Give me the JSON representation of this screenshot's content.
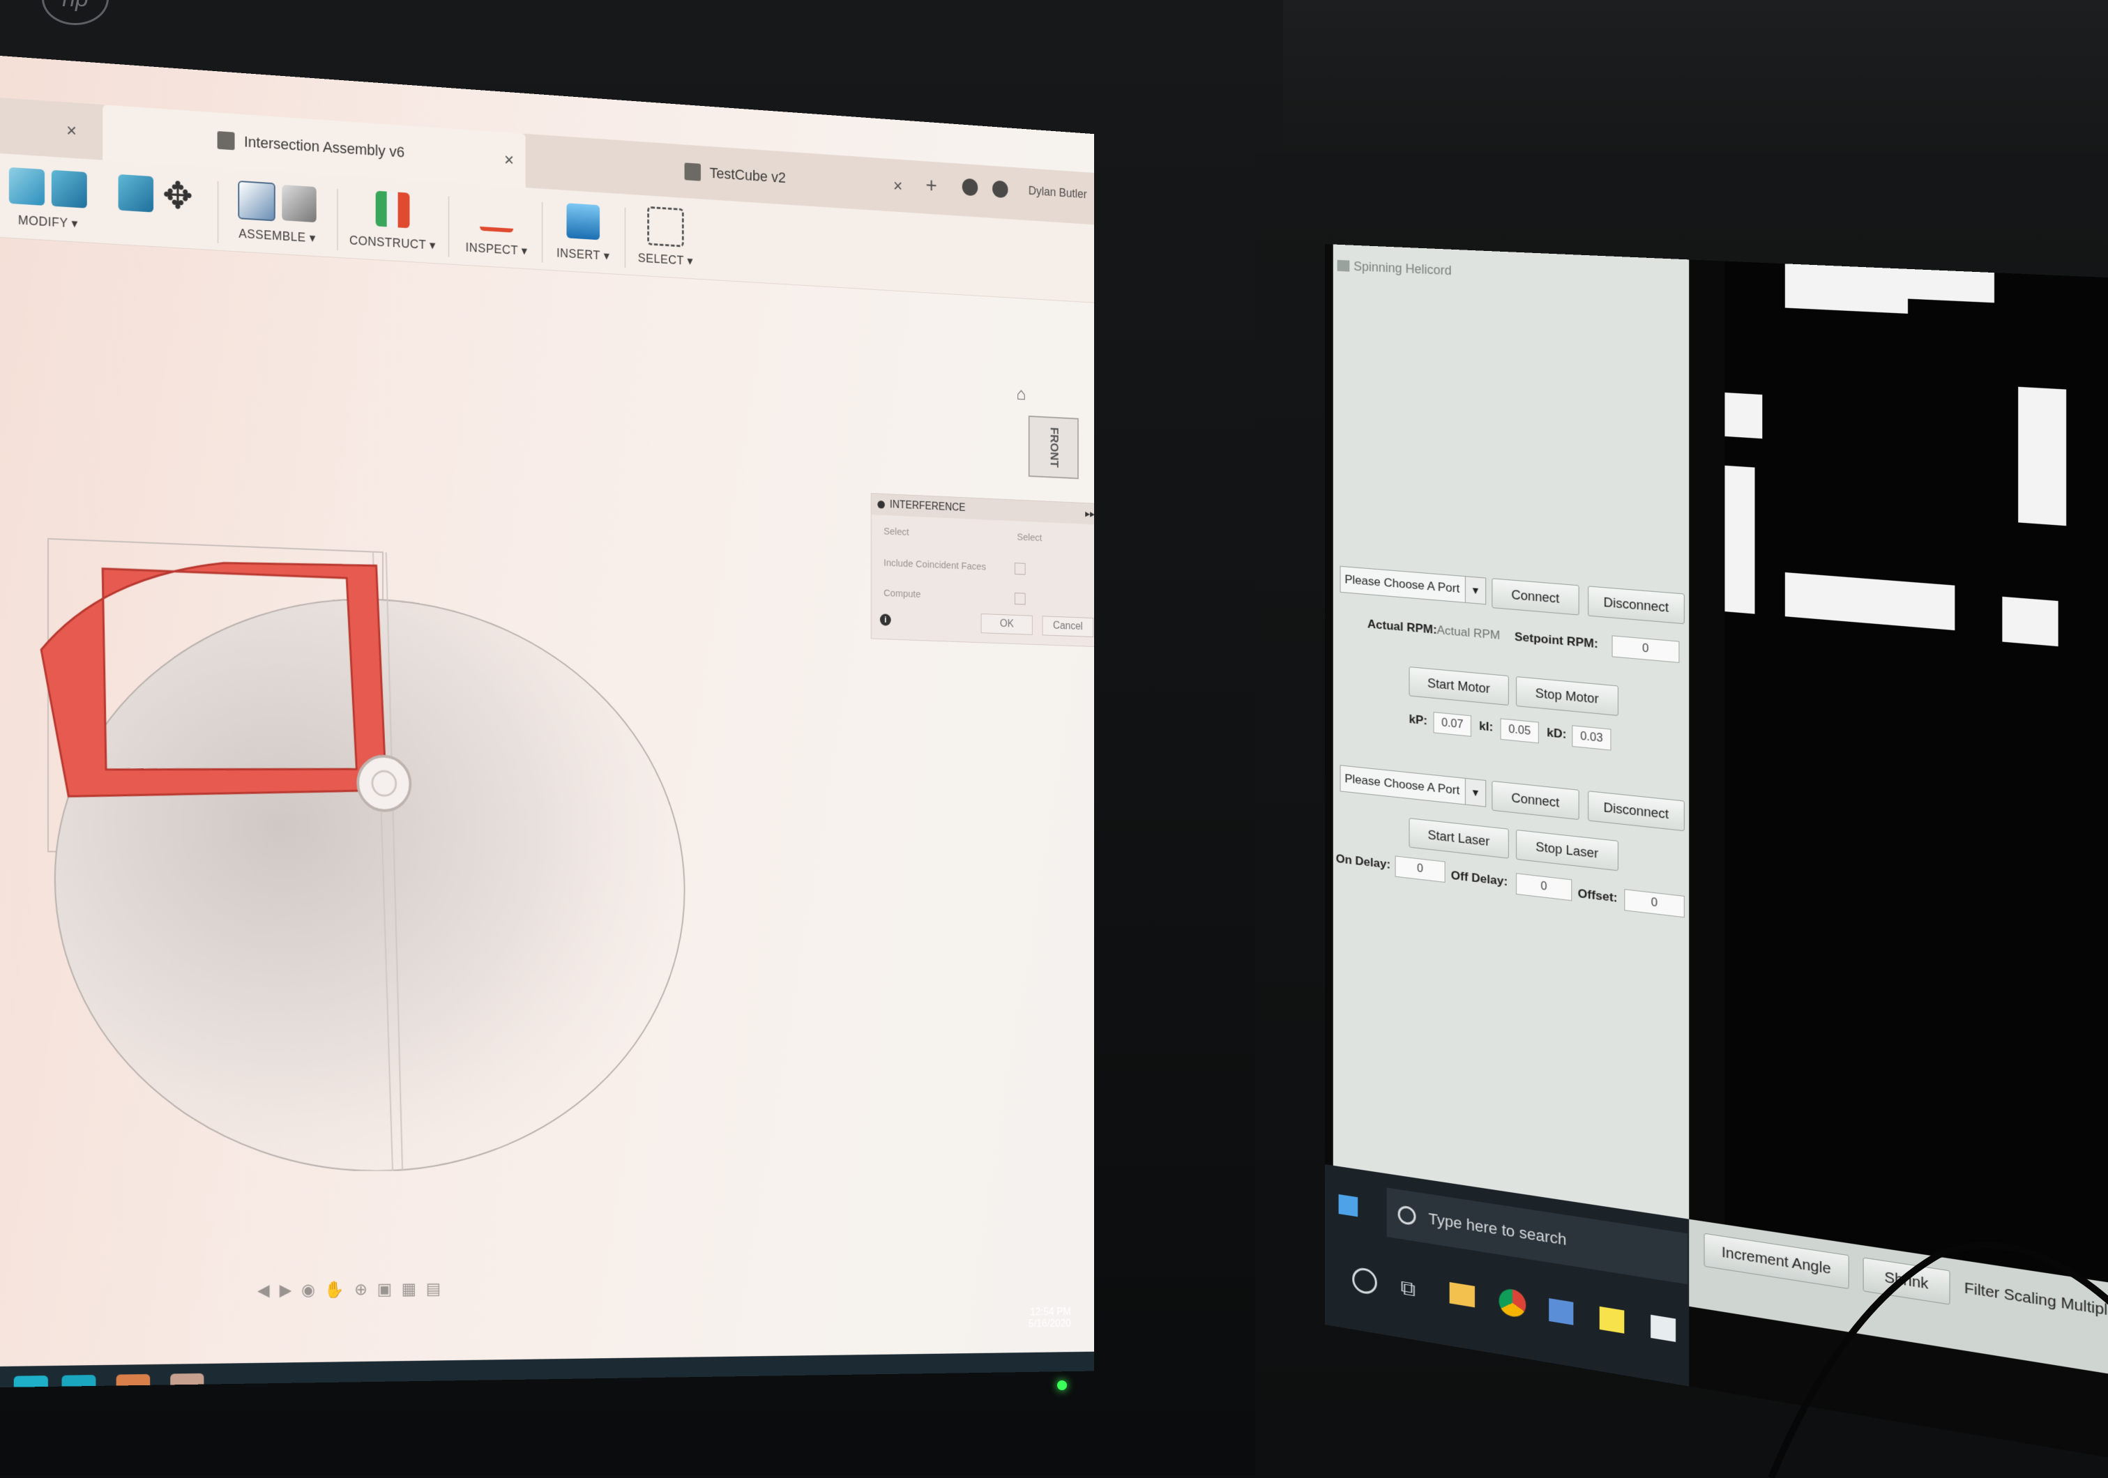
{
  "left_app": {
    "tabs": [
      {
        "label": ""
      },
      {
        "label": "Intersection Assembly v6"
      },
      {
        "label": "TestCube v2"
      }
    ],
    "user_name": "Dylan Butler",
    "toolbar_groups": {
      "modify": "MODIFY ▾",
      "assemble": "ASSEMBLE ▾",
      "construct": "CONSTRUCT ▾",
      "inspect": "INSPECT ▾",
      "insert": "INSERT ▾",
      "select": "SELECT ▾"
    },
    "viewcube_label": "FRONT",
    "interference_panel": {
      "title": "INTERFERENCE",
      "select_label": "Select",
      "select_value": "Select",
      "coincident_label": "Include Coincident Faces",
      "compute_label": "Compute",
      "ok": "OK",
      "cancel": "Cancel"
    },
    "clock": {
      "time": "12:54 PM",
      "date": "5/16/2020"
    }
  },
  "right_app": {
    "window_title": "Spinning Helicord",
    "motor": {
      "port_placeholder": "Please Choose A Port",
      "connect": "Connect",
      "disconnect": "Disconnect",
      "actual_rpm_label": "Actual RPM:",
      "actual_rpm_value": "Actual RPM",
      "setpoint_label": "Setpoint RPM:",
      "setpoint_value": "0",
      "start": "Start Motor",
      "stop": "Stop Motor",
      "kp_label": "kP:",
      "kp_value": "0.07",
      "ki_label": "kI:",
      "ki_value": "0.05",
      "kd_label": "kD:",
      "kd_value": "0.03"
    },
    "laser": {
      "port_placeholder": "Please Choose A Port",
      "connect": "Connect",
      "disconnect": "Disconnect",
      "start": "Start Laser",
      "stop": "Stop Laser",
      "on_delay_label": "On Delay:",
      "on_delay_value": "0",
      "off_delay_label": "Off Delay:",
      "off_delay_value": "0",
      "offset_label": "Offset:",
      "offset_value": "0"
    },
    "bottom_controls": {
      "increment_angle": "Increment Angle",
      "shrink": "Shrink",
      "scaling_label": "Filter Scaling Multiplier"
    },
    "taskbar": {
      "search_placeholder": "Type here to search"
    }
  }
}
